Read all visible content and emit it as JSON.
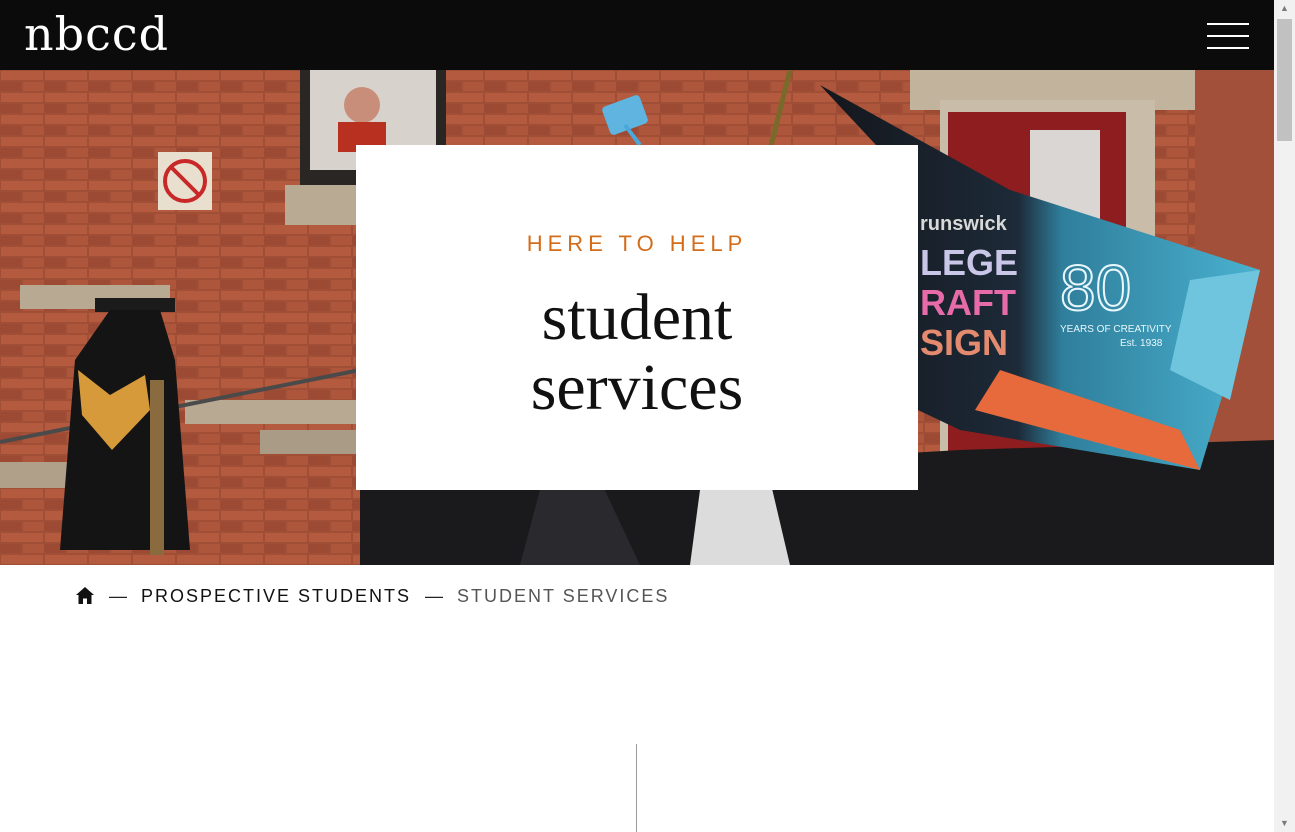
{
  "header": {
    "logo_text": "nbccd",
    "menu_icon": "hamburger-menu-icon",
    "background": "#0b0b0b"
  },
  "hero": {
    "eyebrow": "HERE TO HELP",
    "title_line1": "student",
    "title_line2": "services",
    "eyebrow_color": "#d46d1a",
    "flag_text": [
      "runswick",
      "LEGE",
      "RAFT",
      "SIGN"
    ],
    "flag_80_text": "80",
    "flag_sub": "YEARS OF CREATIVITY",
    "flag_est": "Est. 1938",
    "no_smoking_sign_icon": "no-smoking-sign-icon"
  },
  "breadcrumb": {
    "home_icon": "home-icon",
    "separator": "—",
    "items": [
      {
        "label": "PROSPECTIVE STUDENTS"
      },
      {
        "label": "STUDENT SERVICES"
      }
    ]
  },
  "scrollbar": {
    "up_arrow": "▲",
    "down_arrow": "▼"
  }
}
